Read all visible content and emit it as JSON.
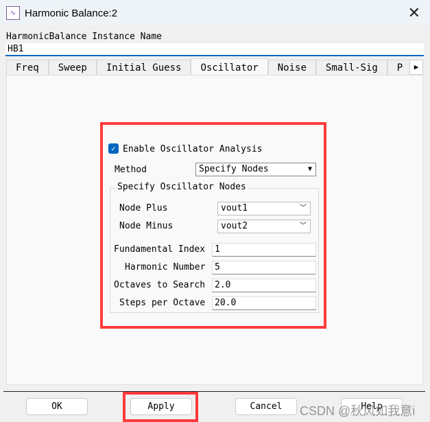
{
  "window": {
    "title": "Harmonic Balance:2",
    "icon": "harmonic-balance-icon"
  },
  "instance": {
    "label": "HarmonicBalance Instance Name",
    "value": "HB1"
  },
  "tabs": [
    {
      "label": "Freq"
    },
    {
      "label": "Sweep"
    },
    {
      "label": "Initial Guess"
    },
    {
      "label": "Oscillator",
      "active": true
    },
    {
      "label": "Noise"
    },
    {
      "label": "Small-Sig"
    },
    {
      "label": "P"
    }
  ],
  "oscillator": {
    "enable_label": "Enable Oscillator Analysis",
    "enabled": true,
    "method_label": "Method",
    "method_value": "Specify Nodes",
    "group_title": "Specify Oscillator Nodes",
    "node_plus_label": "Node Plus",
    "node_plus_value": "vout1",
    "node_minus_label": "Node Minus",
    "node_minus_value": "vout2",
    "fund_index_label": "Fundamental Index",
    "fund_index_value": "1",
    "harmonic_label": "Harmonic Number",
    "harmonic_value": "5",
    "octaves_label": "Octaves to Search",
    "octaves_value": "2.0",
    "steps_label": "Steps per Octave",
    "steps_value": "20.0"
  },
  "buttons": {
    "ok": "OK",
    "apply": "Apply",
    "cancel": "Cancel",
    "help": "Help"
  },
  "highlight_color": "#ff3b3b",
  "watermark": "CSDN @秋风如我意i"
}
